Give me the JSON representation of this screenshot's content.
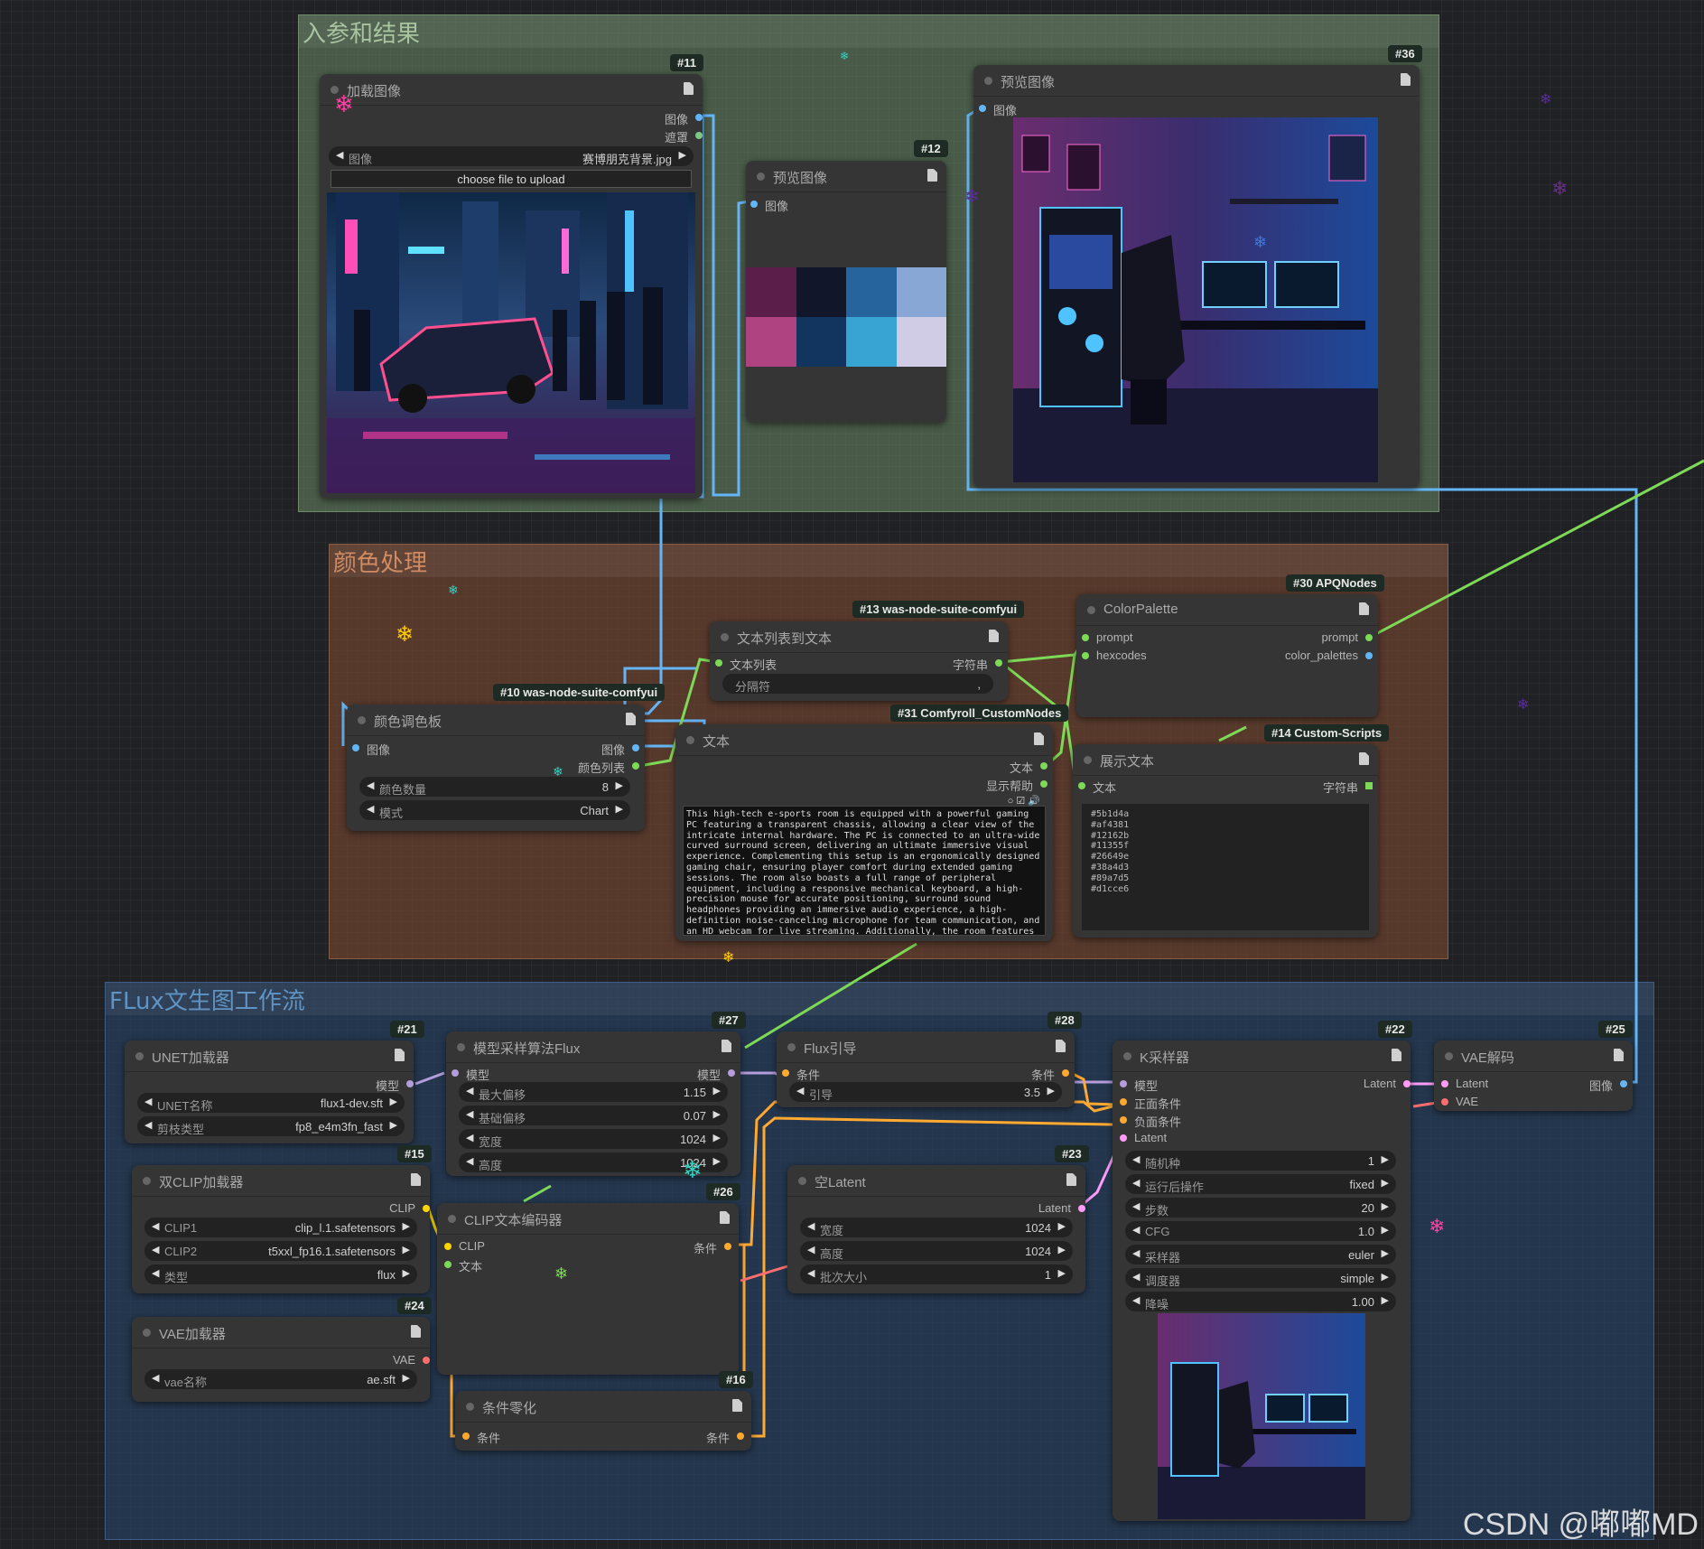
{
  "groups": {
    "io": "入参和结果",
    "color": "颜色处理",
    "flux": "FLux文生图工作流"
  },
  "nodes": {
    "n11": {
      "badge": "#11",
      "title": "加载图像",
      "out_image": "图像",
      "out_mask": "遮罩",
      "widget_image_label": "图像",
      "widget_image_value": "赛博朋克背景.jpg",
      "upload": "choose file to upload"
    },
    "n12": {
      "badge": "#12",
      "title": "预览图像",
      "in_image": "图像"
    },
    "n36": {
      "badge": "#36",
      "title": "预览图像",
      "in_image": "图像"
    },
    "n10": {
      "badge": "#10 was-node-suite-comfyui",
      "title": "颜色调色板",
      "in_image": "图像",
      "out_image": "图像",
      "out_list": "颜色列表",
      "w_count_label": "颜色数量",
      "w_count_value": "8",
      "w_mode_label": "模式",
      "w_mode_value": "Chart"
    },
    "n13": {
      "badge": "#13 was-node-suite-comfyui",
      "title": "文本列表到文本",
      "in_list": "文本列表",
      "out_str": "字符串",
      "w_sep_label": "分隔符",
      "w_sep_value": ","
    },
    "n31": {
      "badge": "#31 Comfyroll_CustomNodes",
      "title": "文本",
      "out_text": "文本",
      "out_help": "显示帮助",
      "text": "This high-tech e-sports room is equipped with a powerful gaming PC featuring a transparent chassis, allowing a clear view of the intricate internal hardware. The PC is connected to an ultra-wide curved surround screen, delivering an ultimate immersive visual experience. Complementing this setup is an ergonomically designed gaming chair, ensuring player comfort during extended gaming sessions. The room also boasts a full range of peripheral equipment, including a responsive mechanical keyboard, a high-precision mouse for accurate positioning, surround sound headphones providing an immersive audio experience, a high-definition noise-canceling microphone for team communication, and an HD webcam for live streaming. Additionally, the room features an adjustable smart"
    },
    "n30": {
      "badge": "#30 APQNodes",
      "title": "ColorPalette",
      "in_prompt": "prompt",
      "in_hex": "hexcodes",
      "out_prompt": "prompt",
      "out_palettes": "color_palettes"
    },
    "n14": {
      "badge": "#14 Custom-Scripts",
      "title": "展示文本",
      "in_text": "文本",
      "out_str": "字符串",
      "text": "#5b1d4a\n#af4381\n#12162b\n#11355f\n#26649e\n#38a4d3\n#89a7d5\n#d1cce6"
    },
    "n21": {
      "badge": "#21",
      "title": "UNET加载器",
      "out_model": "模型",
      "w1_label": "UNET名称",
      "w1_value": "flux1-dev.sft",
      "w2_label": "剪枝类型",
      "w2_value": "fp8_e4m3fn_fast"
    },
    "n27": {
      "badge": "#27",
      "title": "模型采样算法Flux",
      "in_model": "模型",
      "out_model": "模型",
      "w1_label": "最大偏移",
      "w1_value": "1.15",
      "w2_label": "基础偏移",
      "w2_value": "0.07",
      "w3_label": "宽度",
      "w3_value": "1024",
      "w4_label": "高度",
      "w4_value": "1024"
    },
    "n28": {
      "badge": "#28",
      "title": "Flux引导",
      "in_cond": "条件",
      "out_cond": "条件",
      "w1_label": "引导",
      "w1_value": "3.5"
    },
    "n22": {
      "badge": "#22",
      "title": "K采样器",
      "in_model": "模型",
      "in_pos": "正面条件",
      "in_neg": "负面条件",
      "in_latent": "Latent",
      "out_latent": "Latent",
      "w1_label": "随机种",
      "w1_value": "1",
      "w2_label": "运行后操作",
      "w2_value": "fixed",
      "w3_label": "步数",
      "w3_value": "20",
      "w4_label": "CFG",
      "w4_value": "1.0",
      "w5_label": "采样器",
      "w5_value": "euler",
      "w6_label": "调度器",
      "w6_value": "simple",
      "w7_label": "降噪",
      "w7_value": "1.00"
    },
    "n25": {
      "badge": "#25",
      "title": "VAE解码",
      "in_latent": "Latent",
      "in_vae": "VAE",
      "out_image": "图像"
    },
    "n15": {
      "badge": "#15",
      "title": "双CLIP加载器",
      "out_clip": "CLIP",
      "w1_label": "CLIP1",
      "w1_value": "clip_l.1.safetensors",
      "w2_label": "CLIP2",
      "w2_value": "t5xxl_fp16.1.safetensors",
      "w3_label": "类型",
      "w3_value": "flux"
    },
    "n26": {
      "badge": "#26",
      "title": "CLIP文本编码器",
      "in_clip": "CLIP",
      "in_text": "文本",
      "out_cond": "条件"
    },
    "n23": {
      "badge": "#23",
      "title": "空Latent",
      "out_latent": "Latent",
      "w1_label": "宽度",
      "w1_value": "1024",
      "w2_label": "高度",
      "w2_value": "1024",
      "w3_label": "批次大小",
      "w3_value": "1"
    },
    "n24": {
      "badge": "#24",
      "title": "VAE加载器",
      "out_vae": "VAE",
      "w1_label": "vae名称",
      "w1_value": "ae.sft"
    },
    "n16": {
      "badge": "#16",
      "title": "条件零化",
      "in_cond": "条件",
      "out_cond": "条件"
    }
  },
  "palette": [
    "#5b1d4a",
    "#12162b",
    "#26649e",
    "#89a7d5",
    "#af4381",
    "#11355f",
    "#38a4d3",
    "#d1cce6"
  ],
  "link_colors": {
    "image": "#64b5f6",
    "string": "#7ed957",
    "model": "#b39ddb",
    "clip": "#ffd500",
    "vae": "#ff6e6e",
    "conditioning": "#ffa931",
    "latent": "#ff9cf9"
  },
  "watermark": "CSDN @嘟嘟MD"
}
